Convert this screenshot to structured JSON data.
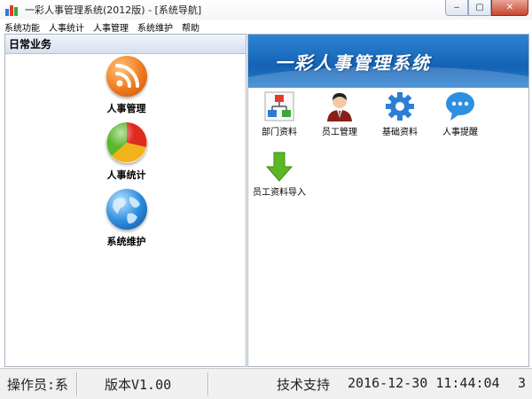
{
  "window": {
    "title": "一彩人事管理系统(2012版) - [系统导航]",
    "controls": {
      "minimize": "‒",
      "maximize": "▢",
      "close": "✕"
    }
  },
  "menu": [
    "系统功能",
    "人事统计",
    "人事管理",
    "系统维护",
    "帮助"
  ],
  "left_panel": {
    "header": "日常业务",
    "items": [
      {
        "label": "人事管理",
        "icon": "rss-icon"
      },
      {
        "label": "人事统计",
        "icon": "pie-chart-icon"
      },
      {
        "label": "系统维护",
        "icon": "globe-icon"
      }
    ]
  },
  "right_panel": {
    "banner_title": "一彩人事管理系统",
    "tools": [
      {
        "label": "部门资料",
        "icon": "org-chart-icon"
      },
      {
        "label": "员工管理",
        "icon": "person-icon"
      },
      {
        "label": "基础资料",
        "icon": "gear-icon"
      },
      {
        "label": "人事提醒",
        "icon": "chat-bubble-icon"
      },
      {
        "label": "员工资料导入",
        "icon": "down-arrow-icon"
      }
    ]
  },
  "status": {
    "operator": "操作员:系",
    "version": "版本V1.00",
    "support": "技术支持",
    "datetime": "2016-12-30 11:44:04",
    "extra": "3"
  },
  "colors": {
    "banner_blue": "#1a6cc0",
    "rss_orange": "#f07a1c",
    "arrow_green": "#5bb822"
  }
}
